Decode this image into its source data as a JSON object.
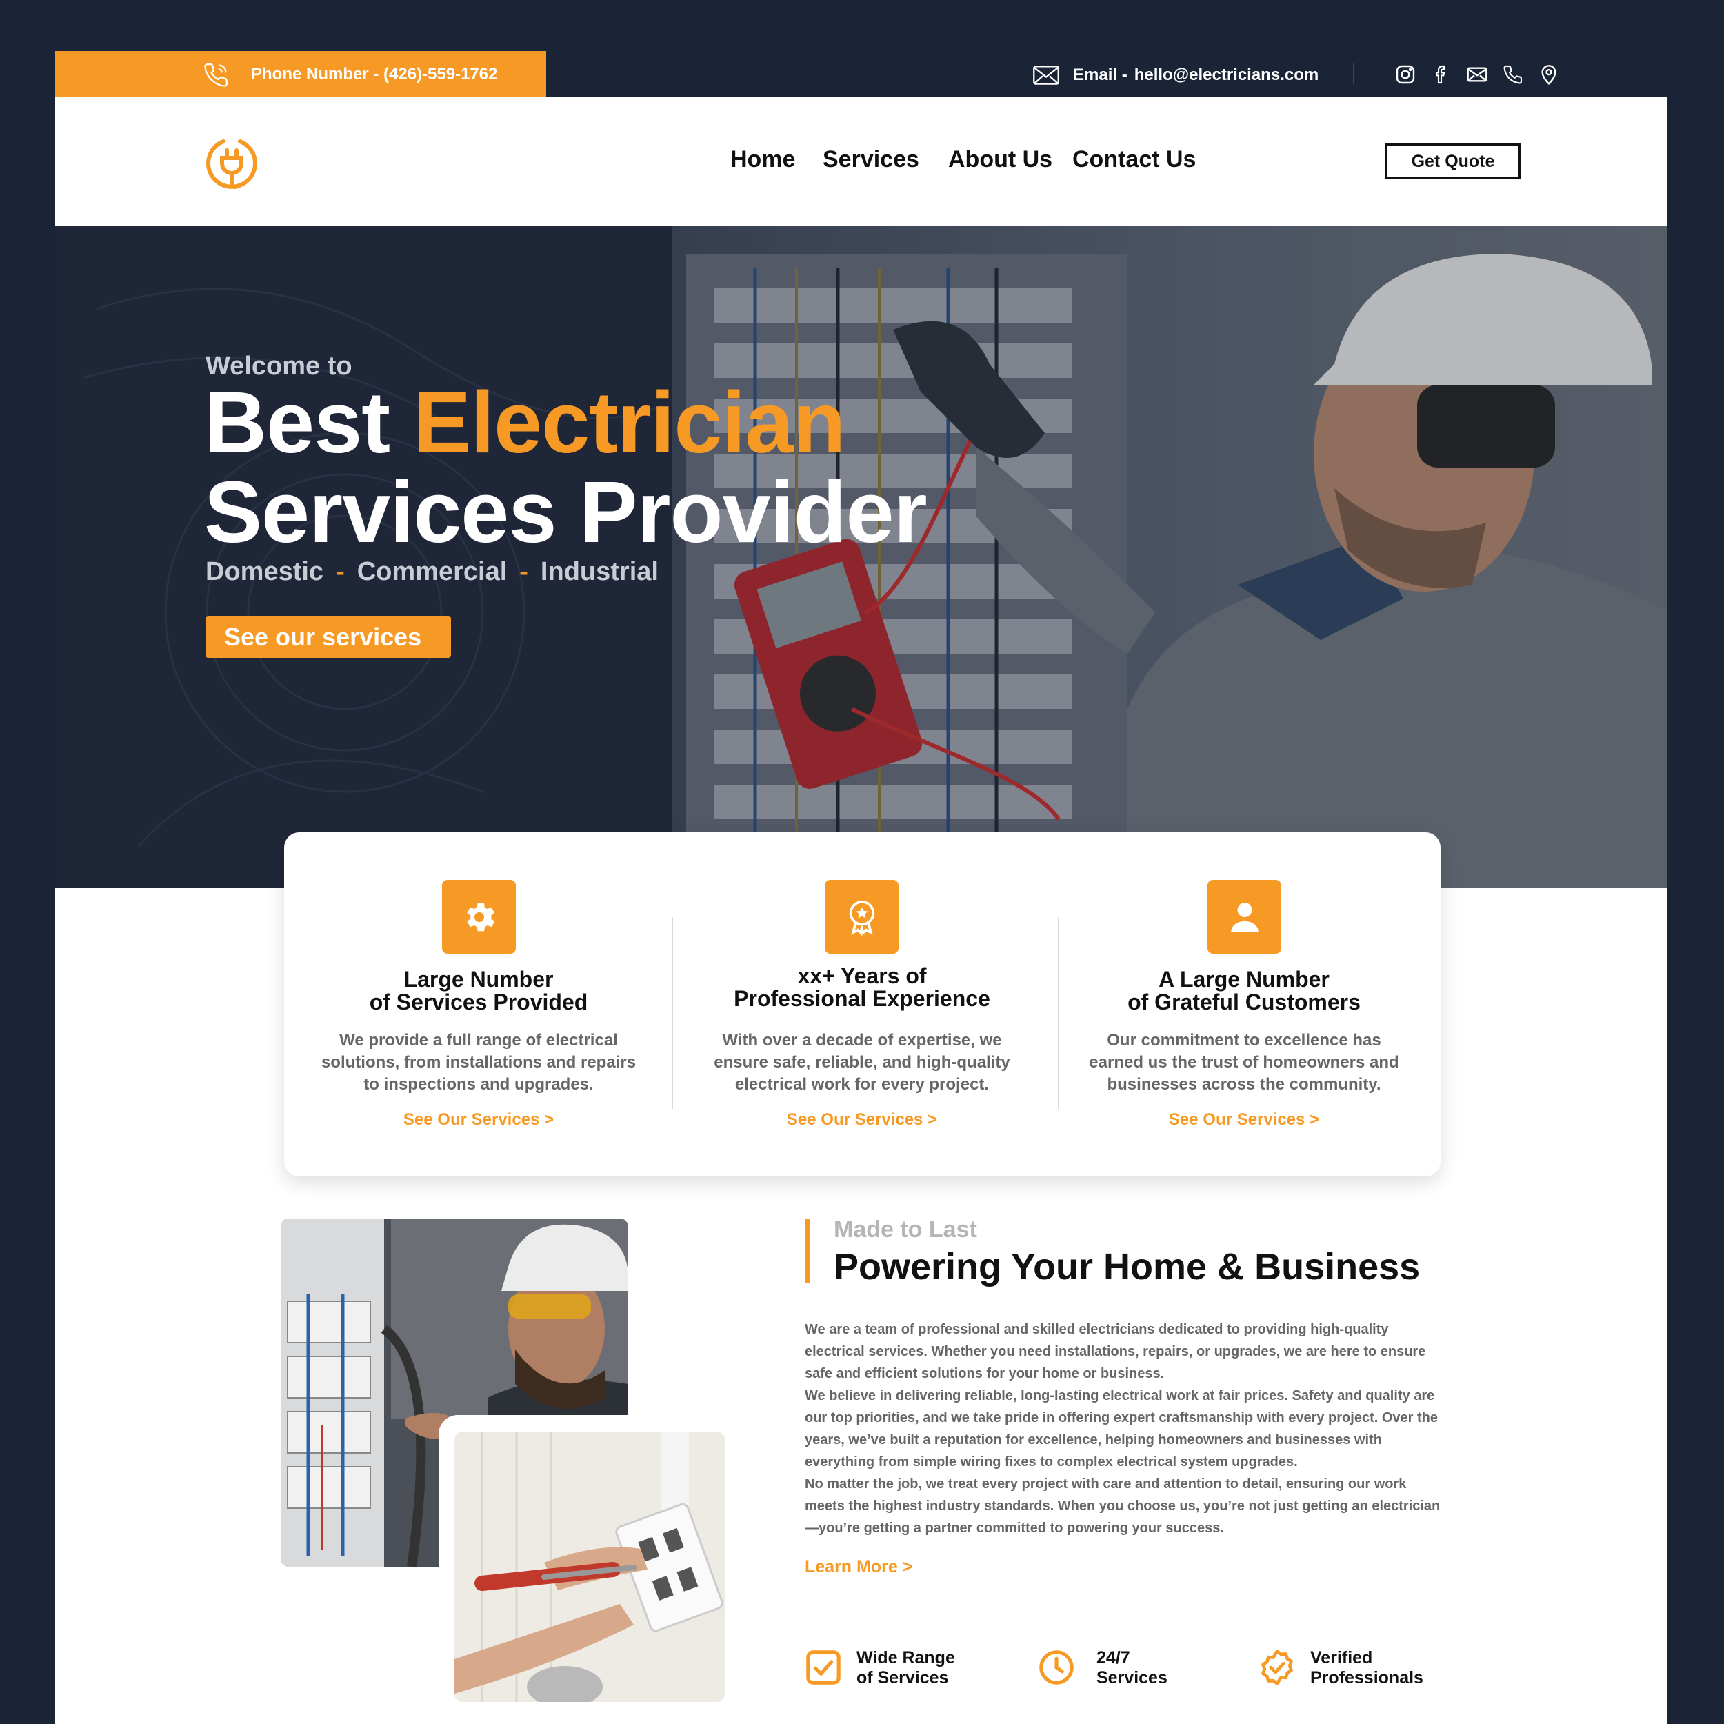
{
  "topbar": {
    "phone_label": "Phone Number - (426)-559-1762",
    "email_label": "Email -",
    "email_value": "hello@electricians.com",
    "social_icons": [
      "instagram-icon",
      "facebook-icon",
      "mail-icon",
      "phone-icon",
      "location-icon"
    ]
  },
  "nav": {
    "items": [
      "Home",
      "Services",
      "About Us",
      "Contact Us"
    ],
    "cta": "Get Quote"
  },
  "hero": {
    "kicker": "Welcome to",
    "title_line1_plain": "Best",
    "title_line1_accent": "Electrician",
    "title_line2": "Services Provider",
    "sub_items": [
      "Domestic",
      "Commercial",
      "Industrial"
    ],
    "separator": "-",
    "button": "See our services"
  },
  "features": [
    {
      "icon": "gear-icon",
      "title_line1": "Large Number",
      "title_line2": "of Services Provided",
      "desc_line1": "We provide a full range of electrical",
      "desc_line2": "solutions, from installations and repairs",
      "desc_line3": "to inspections and upgrades.",
      "link": "See Our Services >"
    },
    {
      "icon": "award-icon",
      "title_line1": "xx+ Years of",
      "title_line2": "Professional Experience",
      "desc_line1": "With over a decade of expertise, we",
      "desc_line2": "ensure safe, reliable, and high-quality",
      "desc_line3": "electrical work for every project.",
      "link": "See Our Services >"
    },
    {
      "icon": "user-icon",
      "title_line1": "A Large Number",
      "title_line2": "of Grateful Customers",
      "desc_line1": "Our commitment to excellence has",
      "desc_line2": "earned us the trust of homeowners and",
      "desc_line3": "businesses across the community.",
      "link": "See Our Services >"
    }
  ],
  "about": {
    "kicker": "Made to Last",
    "title": "Powering Your Home & Business",
    "lines": [
      "We are a team of professional and skilled electricians dedicated to providing high-quality",
      "electrical services. Whether you need installations, repairs, or upgrades, we are here to ensure",
      "safe and efficient solutions for your home or business.",
      "We believe in delivering reliable, long-lasting electrical work at fair prices. Safety and quality are",
      "our top priorities, and we take pride in offering expert craftsmanship with every project. Over the",
      "years, we’ve built a reputation for excellence, helping homeowners and businesses with",
      "everything from simple wiring fixes to complex electrical system upgrades.",
      "No matter the job, we treat every project with care and attention to detail, ensuring our work",
      "meets the highest industry standards. When you choose us, you’re not just getting an electrician",
      "—you’re getting a partner committed to powering your success."
    ],
    "learn_more": "Learn More >",
    "badges": [
      {
        "icon": "checkbox-icon",
        "line1": "Wide Range",
        "line2": "of Services"
      },
      {
        "icon": "clock-icon",
        "line1": "24/7",
        "line2": "Services"
      },
      {
        "icon": "verified-badge-icon",
        "line1": "Verified",
        "line2": "Professionals"
      }
    ]
  },
  "colors": {
    "accent": "#f79a25",
    "dark": "#1b2436",
    "text_muted": "#666666"
  }
}
